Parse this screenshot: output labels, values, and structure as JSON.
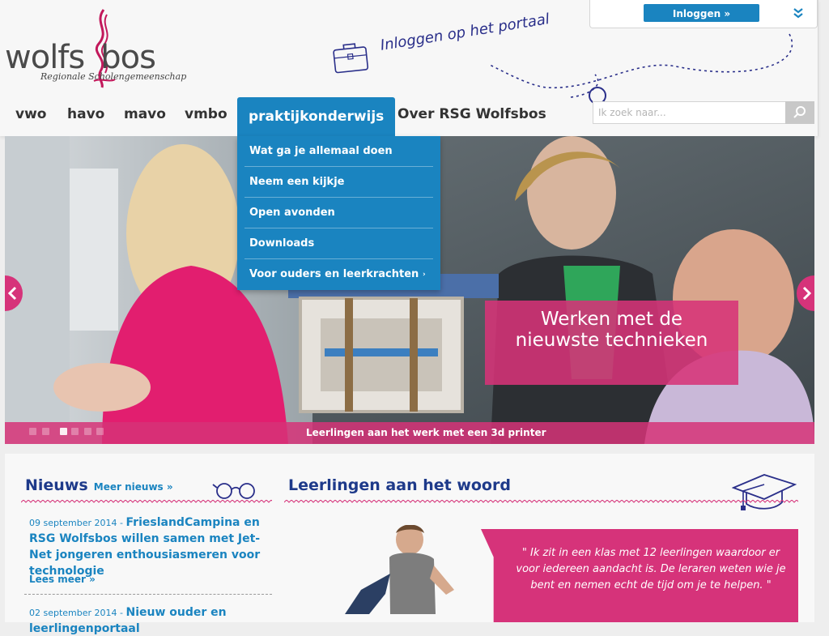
{
  "logo": {
    "name_part1": "wolfs",
    "name_part2": "bos",
    "subtitle": "Regionale  Scholengemeenschap"
  },
  "login": {
    "button_label": "Inloggen »",
    "portal_text": "Inloggen op het portaal"
  },
  "nav": {
    "items": [
      "vwo",
      "havo",
      "mavo",
      "vmbo",
      "praktijkonderwijs",
      "Over RSG Wolfsbos"
    ],
    "active": "praktijkonderwijs"
  },
  "search": {
    "placeholder": "Ik zoek naar..."
  },
  "dropdown": {
    "items": [
      "Wat ga je allemaal doen",
      "Neem een kijkje",
      "Open avonden",
      "Downloads",
      "Voor ouders en leerkrachten"
    ],
    "submenu_caret": "›"
  },
  "slider": {
    "caption_line1": "Werken met de",
    "caption_line2": "nieuwste technieken",
    "strip_text": "Leerlingen aan het werk met een 3d printer",
    "dot_count": 5,
    "active_dot": 3
  },
  "news": {
    "title": "Nieuws",
    "more_label": "Meer nieuws »",
    "items": [
      {
        "date": "09 september 2014",
        "title": "FrieslandCampina en RSG Wolfsbos willen samen met Jet-Net jongeren enthousiasmeren voor technologie",
        "read_more": "Lees meer »"
      },
      {
        "date": "02 september 2014",
        "title": "Nieuw ouder en leerlingenportaal"
      }
    ]
  },
  "woord": {
    "title": "Leerlingen aan het woord",
    "quote": "\" Ik zit in een klas met 12 leerlingen waardoor er voor iedereen aandacht is. De leraren weten wie je bent en nemen echt de tijd om je te helpen. \""
  },
  "colors": {
    "accent_blue": "#1a84c0",
    "accent_pink": "#d6337a",
    "heading_navy": "#1e3a8a"
  }
}
